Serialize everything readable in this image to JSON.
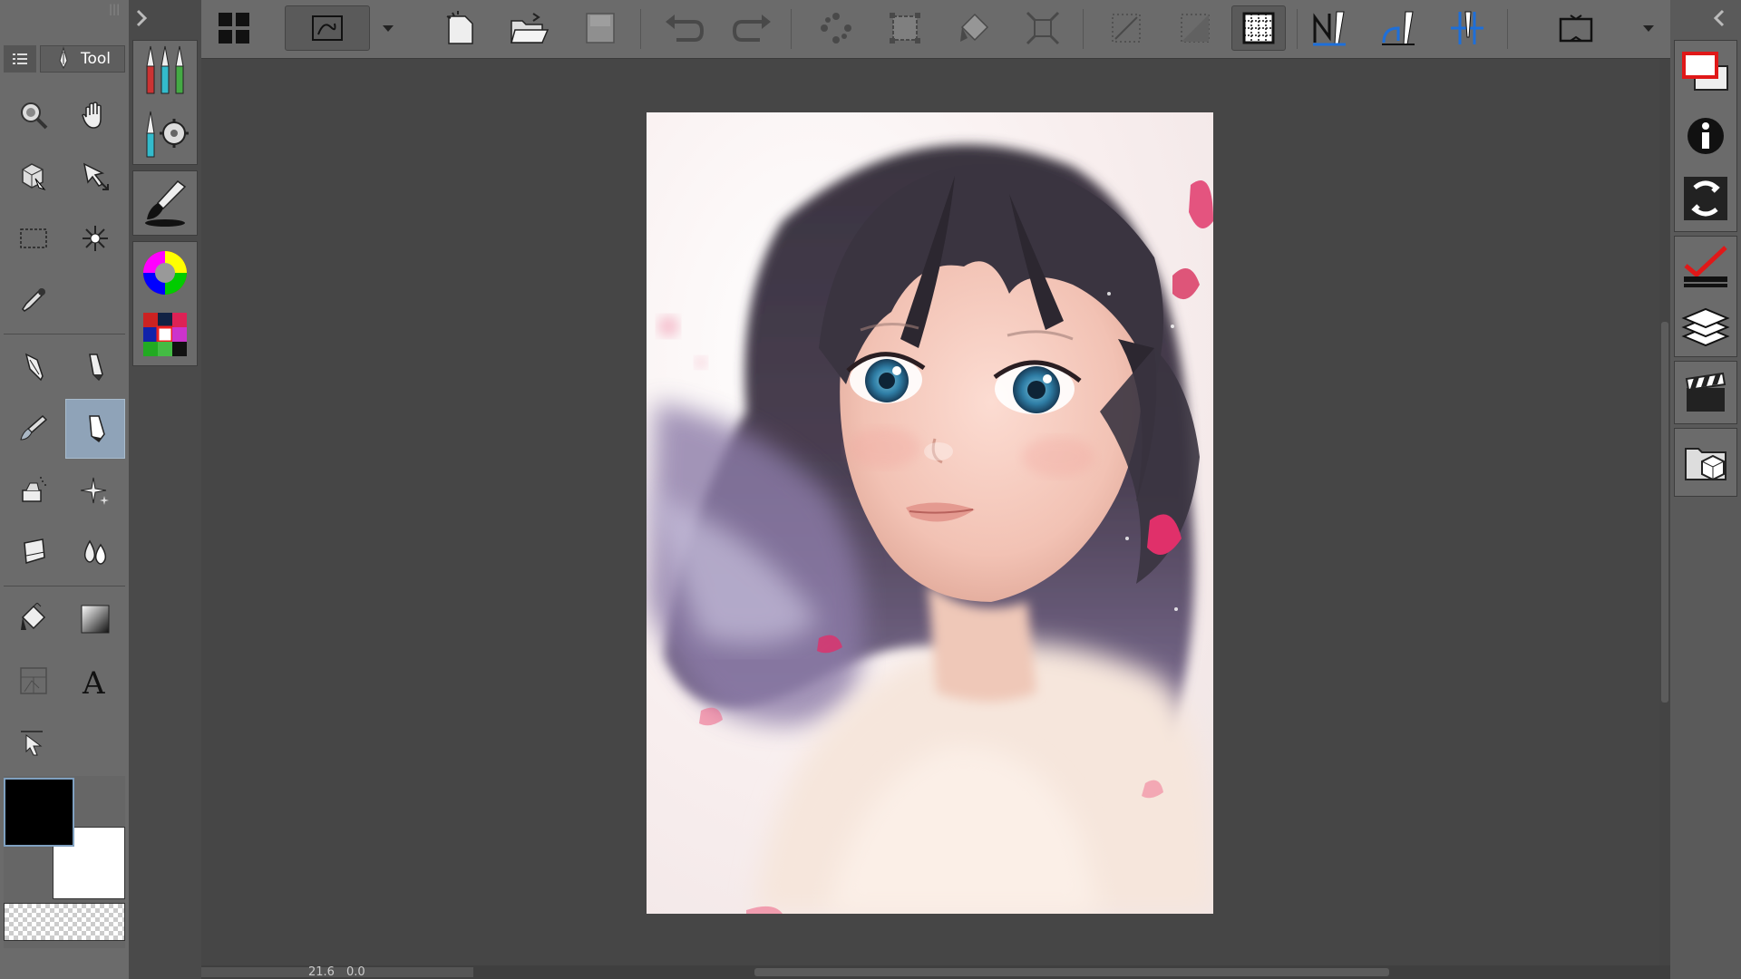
{
  "tool_panel": {
    "header_label": "Tool",
    "tools": [
      "zoom",
      "hand",
      "object",
      "move",
      "marquee",
      "auto-select",
      "eyedropper",
      "pen",
      "pencil",
      "brush",
      "decoration",
      "airbrush",
      "sparkle",
      "eraser",
      "blend",
      "fill",
      "gradient",
      "frame",
      "text",
      "ruler"
    ]
  },
  "status": {
    "zoom": "21.6",
    "rotation": "0.0"
  },
  "colors": {
    "main_color": "#000000",
    "sub_color": "#ffffff",
    "accent_active": "#8fa3b8",
    "ruler_blue": "#1e6fd9"
  },
  "top_toolbar": {
    "items": [
      "palette-menu",
      "canvas-view",
      "dropdown",
      "new-file",
      "open-file",
      "save",
      "undo",
      "redo",
      "clear-selection",
      "transform-selection",
      "fill-selection",
      "fit-selection",
      "snap-off",
      "snap-on",
      "grid",
      "ruler-snap",
      "perspective-snap",
      "special-ruler",
      "fullscreen"
    ]
  },
  "right_panel": {
    "buttons": [
      "layer-property",
      "info",
      "navigator",
      "sub-view",
      "layer",
      "animation",
      "material"
    ]
  }
}
